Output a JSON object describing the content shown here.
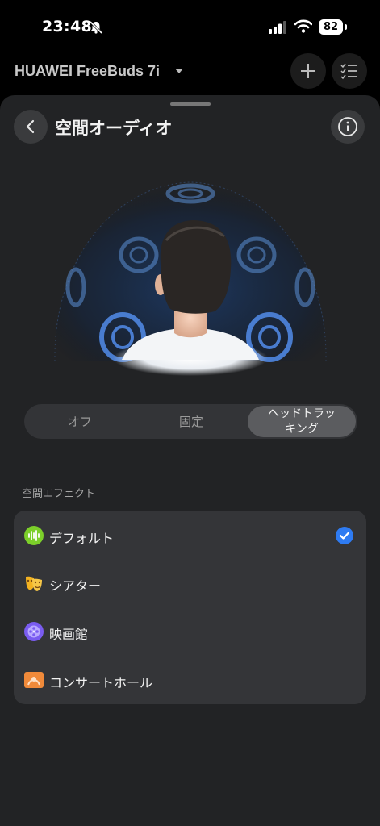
{
  "status_bar": {
    "time": "23:48",
    "battery": "82"
  },
  "header": {
    "device_name": "HUAWEI FreeBuds 7i"
  },
  "sheet": {
    "title": "空間オーディオ"
  },
  "segment": {
    "options": [
      "オフ",
      "固定",
      "ヘッドトラッ\nキング"
    ],
    "selected_index": 2
  },
  "section_label": "空間エフェクト",
  "effects": [
    {
      "label": "デフォルト",
      "icon": "audio-wave-icon",
      "color": "#7ccf2a",
      "selected": true
    },
    {
      "label": "シアター",
      "icon": "theater-mask-icon",
      "color": "#f4b321",
      "selected": false
    },
    {
      "label": "映画館",
      "icon": "film-reel-icon",
      "color": "#7a5cf0",
      "selected": false
    },
    {
      "label": "コンサートホール",
      "icon": "concert-hall-icon",
      "color": "#f08a3a",
      "selected": false
    }
  ],
  "colors": {
    "accent": "#2e7bf2",
    "sheet_bg": "#222325",
    "card_bg": "#343538"
  }
}
